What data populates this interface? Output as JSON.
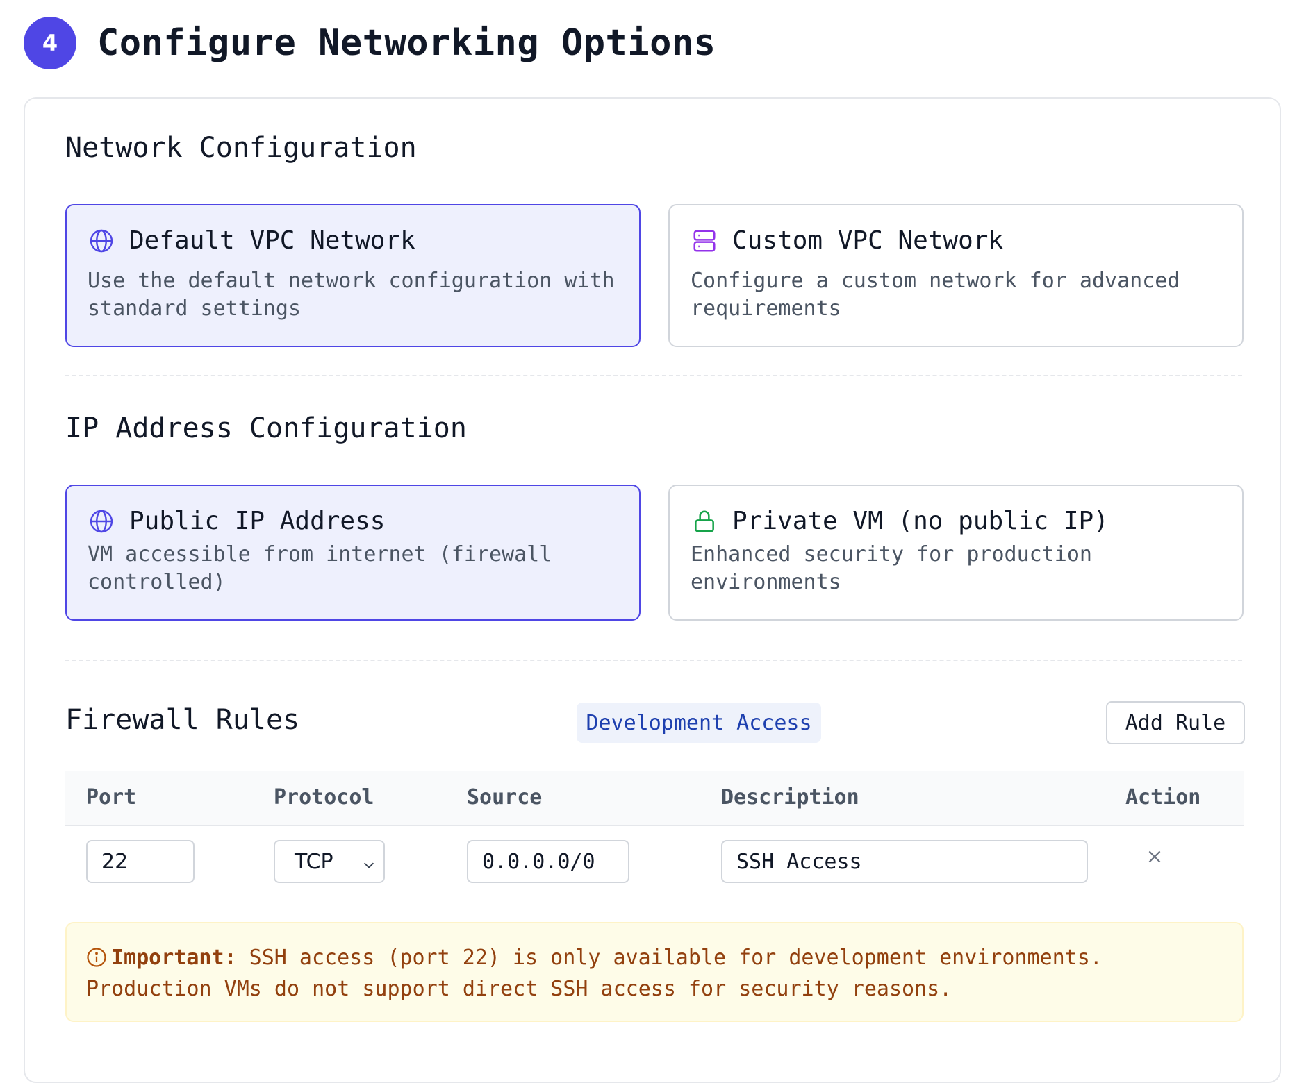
{
  "header": {
    "step_number": "4",
    "title": "Configure Networking Options"
  },
  "network": {
    "section_title": "Network Configuration",
    "options": [
      {
        "title": "Default VPC Network",
        "desc": "Use the default network configuration with standard settings",
        "icon": "globe-icon",
        "selected": true
      },
      {
        "title": "Custom VPC Network",
        "desc": "Configure a custom network for advanced requirements",
        "icon": "server-icon",
        "selected": false
      }
    ]
  },
  "ip": {
    "section_title": "IP Address Configuration",
    "options": [
      {
        "title": "Public IP Address",
        "desc": "VM accessible from internet (firewall controlled)",
        "icon": "globe-icon",
        "selected": true
      },
      {
        "title": "Private VM (no public IP)",
        "desc": "Enhanced security for production environments",
        "icon": "lock-icon",
        "selected": false
      }
    ]
  },
  "firewall": {
    "section_title": "Firewall Rules",
    "tag": "Development Access",
    "add_label": "Add Rule",
    "columns": {
      "port": "Port",
      "protocol": "Protocol",
      "source": "Source",
      "description": "Description",
      "action": "Action"
    },
    "rows": [
      {
        "port": "22",
        "protocol": "TCP",
        "source": "0.0.0.0/0",
        "description": "SSH Access"
      }
    ]
  },
  "notice": {
    "label": "Important:",
    "text": " SSH access (port 22) is only available for development environments. Production VMs do not support direct SSH access for security reasons."
  },
  "colors": {
    "accent": "#4f46e5",
    "selected_bg": "#eef0fd",
    "warning_text": "#92400e",
    "warning_bg": "#fefce8",
    "lock_green": "#16a34a",
    "server_purple": "#9333ea"
  }
}
